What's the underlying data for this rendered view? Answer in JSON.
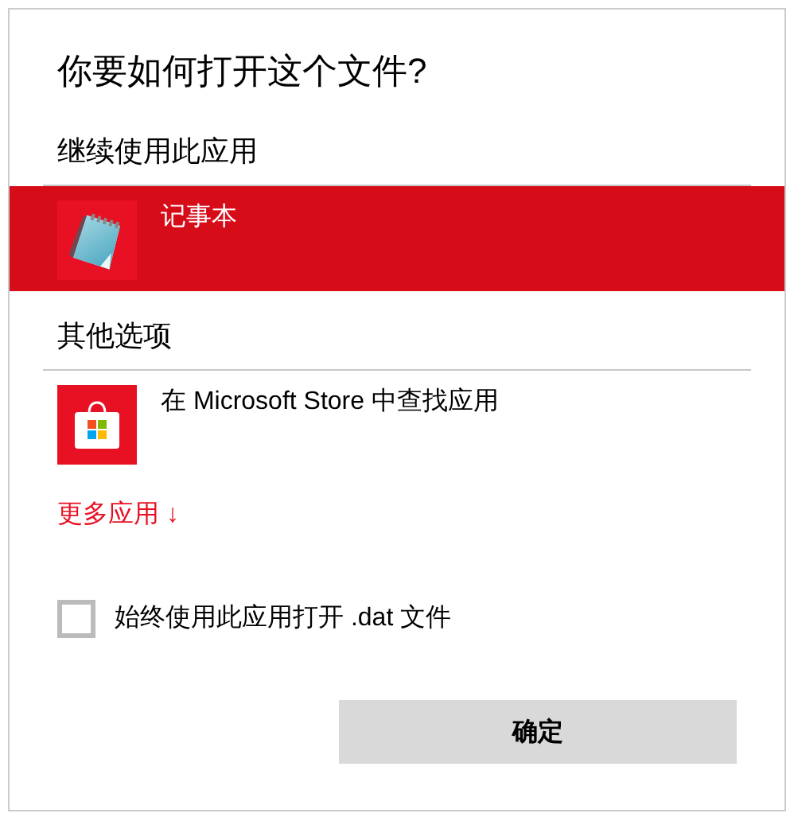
{
  "title": "你要如何打开这个文件?",
  "sections": [
    {
      "header": "继续使用此应用",
      "apps": [
        {
          "name": "记事本",
          "kind": "notepad",
          "selected": true
        }
      ]
    },
    {
      "header": "其他选项",
      "apps": [
        {
          "name": "在 Microsoft Store 中查找应用",
          "kind": "store",
          "selected": false
        }
      ]
    }
  ],
  "more_apps_link": "更多应用 ↓",
  "always_open": {
    "label": "始终使用此应用打开 .dat 文件",
    "checked": false
  },
  "ok_button": "确定"
}
